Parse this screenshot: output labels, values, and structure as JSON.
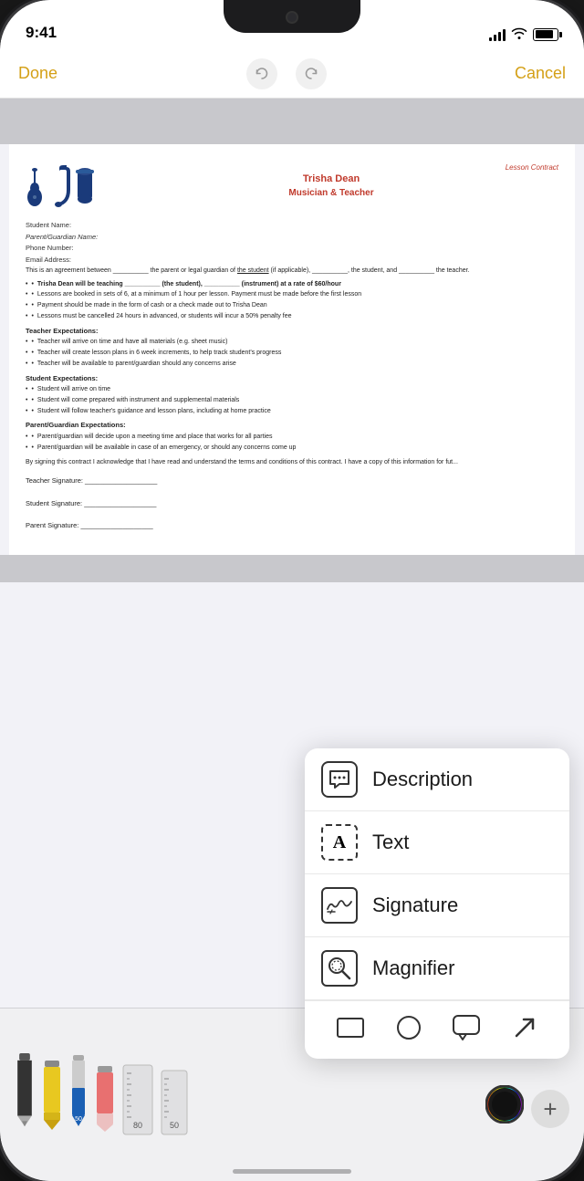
{
  "status_bar": {
    "time": "9:41",
    "signal": 4,
    "wifi": true,
    "battery": 85
  },
  "nav": {
    "done_label": "Done",
    "cancel_label": "Cancel",
    "undo_icon": "undo",
    "redo_icon": "redo"
  },
  "document": {
    "contract_label": "Lesson Contract",
    "teacher_name": "Trisha Dean",
    "teacher_title": "Musician & Teacher",
    "fields": [
      "Student Name:",
      "Parent/Guardian Name:",
      "Phone Number:",
      "Email Address:"
    ],
    "body_text": "This is an agreement between __________ the parent or legal guardian of the student (if applicable), __________, the student, and __________ the teacher.",
    "bullets_main": [
      "Trisha Dean will be teaching __________ (the student), __________ (instrument) at a rate of $60/hour",
      "Lessons are booked in sets of 6, at a minimum of 1 hour per lesson. Payment must be made before the first lesson",
      "Payment should be made in the form of cash or a check made out to Trisha Dean",
      "Lessons must be cancelled 24 hours in advanced, or students will incur a 50% penalty fee"
    ],
    "sections": [
      {
        "title": "Teacher Expectations:",
        "bullets": [
          "Teacher will arrive on time and have all materials (e.g. sheet music)",
          "Teacher will create lesson plans in 6 week increments, to help track student's progress",
          "Teacher will be available to parent/guardian should any concerns arise"
        ]
      },
      {
        "title": "Student Expectations:",
        "bullets": [
          "Student will arrive on time",
          "Student will come prepared with instrument and supplemental materials",
          "Student will follow teacher's guidance and lesson plans, including at home practice"
        ]
      },
      {
        "title": "Parent/Guardian Expectations:",
        "bullets": [
          "Parent/guardian will decide upon a meeting time and place that works for all parties",
          "Parent/guardian will be available in case of an emergency, or should any concerns come up"
        ]
      }
    ],
    "closing_text": "By signing this contract I acknowledge that I have read and understand the terms and conditions of this contract. I have a copy of this information for fut...",
    "signatures": [
      "Teacher Signature: ___________________",
      "Student Signature: ___________________",
      "Parent Signature: ___________________"
    ]
  },
  "popup_menu": {
    "items": [
      {
        "id": "description",
        "label": "Description",
        "icon": "speech-bubble"
      },
      {
        "id": "text",
        "label": "Text",
        "icon": "text-box"
      },
      {
        "id": "signature",
        "label": "Signature",
        "icon": "signature-squiggle"
      },
      {
        "id": "magnifier",
        "label": "Magnifier",
        "icon": "magnifier-glass"
      }
    ],
    "shapes": [
      {
        "id": "rectangle",
        "icon": "□"
      },
      {
        "id": "circle",
        "icon": "○"
      },
      {
        "id": "speech",
        "icon": "💬"
      },
      {
        "id": "arrow",
        "icon": "↗"
      }
    ]
  },
  "toolbar": {
    "tools": [
      {
        "id": "pencil",
        "type": "pencil",
        "color": "#222"
      },
      {
        "id": "highlighter-yellow",
        "type": "highlighter",
        "color": "#e8c820"
      },
      {
        "id": "pen-blue",
        "type": "pen",
        "color": "#1a5fb4",
        "number": "50"
      },
      {
        "id": "eraser",
        "type": "eraser",
        "color": "#c8484a"
      },
      {
        "id": "ruler1",
        "type": "ruler",
        "number": "80"
      },
      {
        "id": "ruler2",
        "type": "ruler",
        "number": "50"
      }
    ],
    "color_picker": true,
    "add_button_label": "+"
  }
}
